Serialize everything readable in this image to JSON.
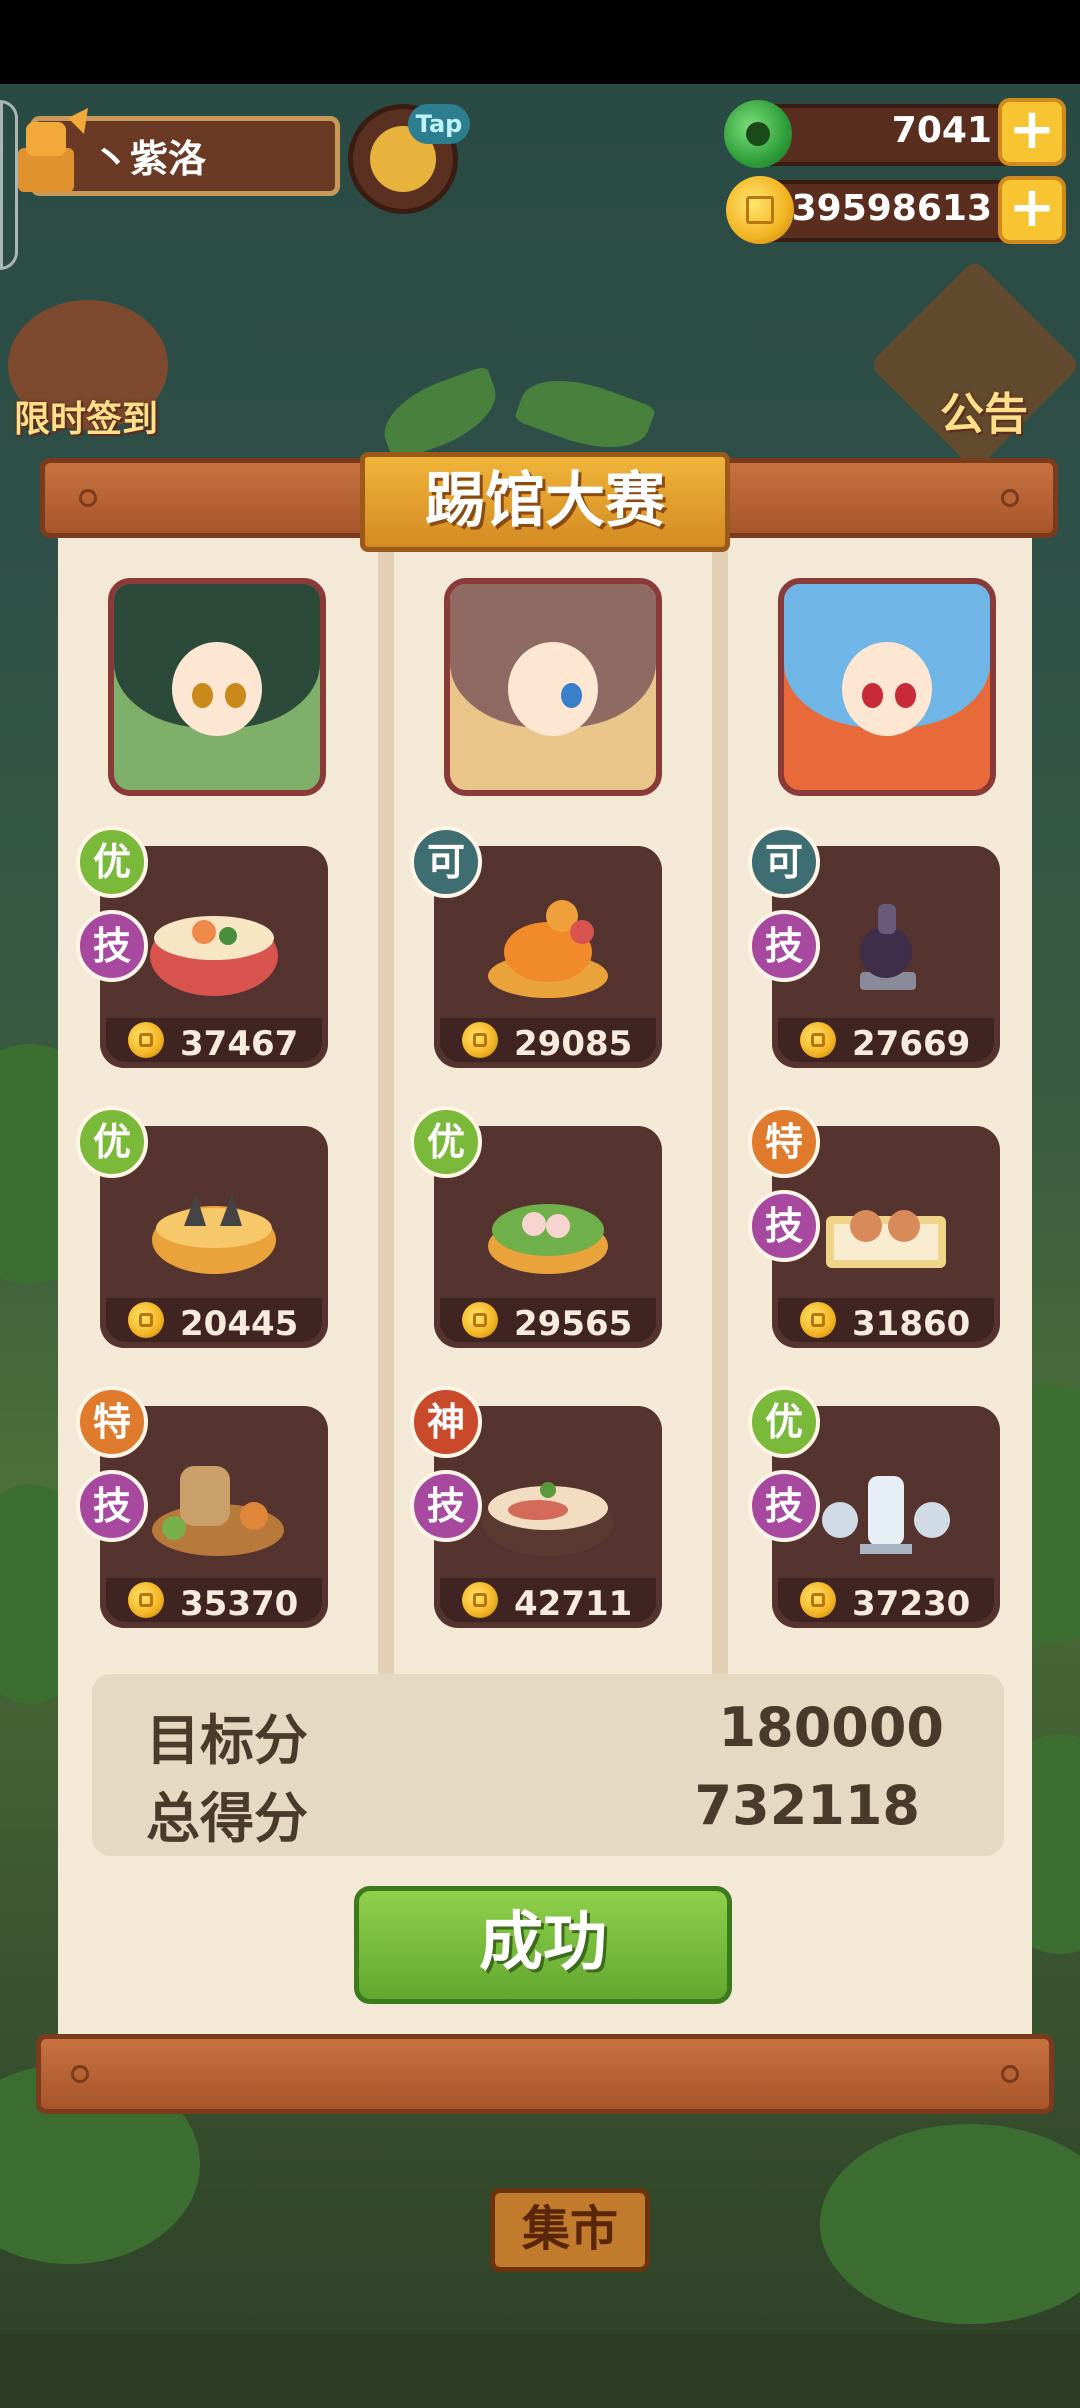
{
  "player": {
    "name": "丶紫洛",
    "tap_label": "Tap"
  },
  "resources": {
    "jade": "7041",
    "coins": "39598613",
    "add": "+"
  },
  "side_buttons": {
    "checkin": "限时签到",
    "notice": "公告"
  },
  "dialog": {
    "title": "踢馆大赛",
    "columns": [
      {
        "dishes": [
          {
            "grade": "优",
            "grade_color": "#7bb93a",
            "skill": "技",
            "score": "37467"
          },
          {
            "grade": "优",
            "grade_color": "#7bb93a",
            "skill": "",
            "score": "20445"
          },
          {
            "grade": "特",
            "grade_color": "#e07b2d",
            "skill": "技",
            "score": "35370"
          }
        ]
      },
      {
        "dishes": [
          {
            "grade": "可",
            "grade_color": "#3f6e72",
            "skill": "",
            "score": "29085"
          },
          {
            "grade": "优",
            "grade_color": "#7bb93a",
            "skill": "",
            "score": "29565"
          },
          {
            "grade": "神",
            "grade_color": "#c94a2a",
            "skill": "技",
            "score": "42711"
          }
        ]
      },
      {
        "dishes": [
          {
            "grade": "可",
            "grade_color": "#3f6e72",
            "skill": "技",
            "score": "27669"
          },
          {
            "grade": "特",
            "grade_color": "#e07b2d",
            "skill": "技",
            "score": "31860"
          },
          {
            "grade": "优",
            "grade_color": "#7bb93a",
            "skill": "技",
            "score": "37230"
          }
        ]
      }
    ],
    "target_label": "目标分",
    "target_value": "180000",
    "total_label": "总得分",
    "total_value": "732118",
    "result_button": "成功"
  },
  "bottom": {
    "market": "集市"
  },
  "colors": {
    "skill_badge": "#a7499f",
    "card_bg": "#553430",
    "panel_bg": "#f4e9d6"
  }
}
